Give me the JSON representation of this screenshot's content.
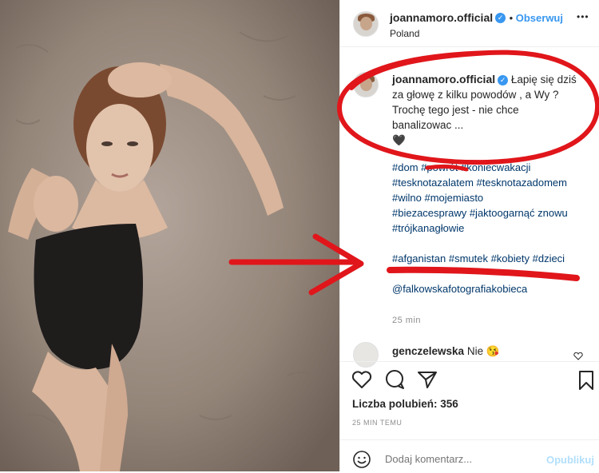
{
  "post": {
    "username": "joannamoro.official",
    "follow_label": "Obserwuj",
    "location": "Poland",
    "more_label": "•••"
  },
  "caption": {
    "username": "joannamoro.official",
    "text_line1": "Łapię się dziś",
    "text_line2": "za głowę z kilku powodów , a Wy ?",
    "text_line3": "Trochę tego jest - nie chce",
    "text_line4": "banalizowac ...",
    "emoji": "🖤",
    "hashtags": [
      "#dom #powrót #koniecwakacji",
      "#tesknotazalatem #tesknotazadomem",
      "#wilno #mojemiasto",
      "#biezacesprawy #jaktoogarnąć znowu",
      "#trójkanagłowie"
    ],
    "hashtags2": "#afganistan #smutek #kobiety #dzieci",
    "mention": "@falkowskafotografiakobieca",
    "time": "25 min"
  },
  "comment": {
    "username": "genczelewska",
    "text": "Nie 😘"
  },
  "likes_label": "Liczba polubień: 356",
  "timestamp": "25 MIN TEMU",
  "comment_box": {
    "placeholder": "Dodaj komentarz...",
    "publish_label": "Opublikuj"
  },
  "colors": {
    "link": "#00376b",
    "accent": "#3897f0",
    "annotation": "#e0161b"
  },
  "icons": [
    "heart-icon",
    "comment-icon",
    "share-icon",
    "bookmark-icon",
    "emoji-icon",
    "verified-icon",
    "avatar"
  ]
}
